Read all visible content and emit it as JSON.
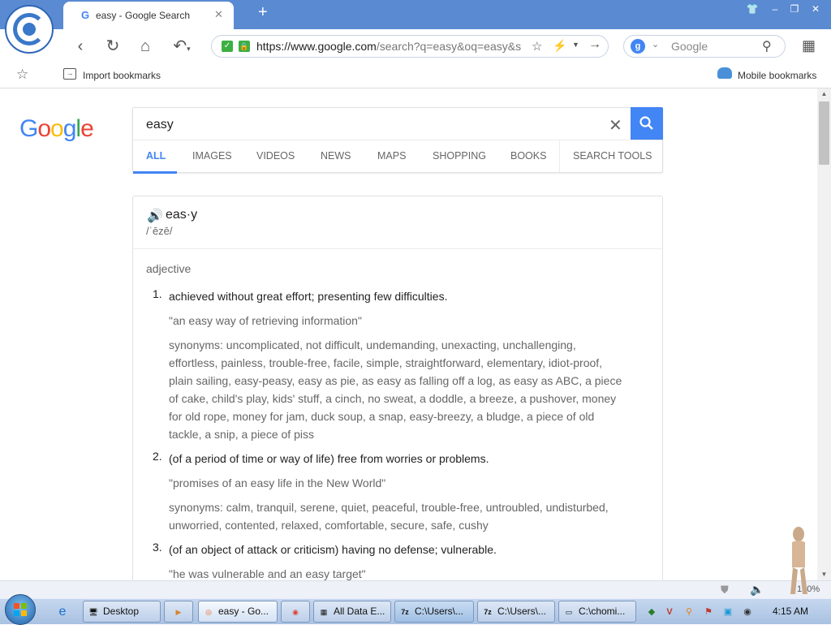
{
  "browser": {
    "tab": {
      "title": "easy - Google Search",
      "favicon": "G",
      "close": "✕"
    },
    "new_tab_icon": "+",
    "window_controls": {
      "shirt": "👕",
      "minimize": "–",
      "restore": "❐",
      "close": "✕"
    },
    "address": {
      "url_host": "https://www.google.com",
      "url_path": "/search?q=easy&oq=easy&s"
    },
    "search_placeholder": "Google",
    "engine_letter": "g"
  },
  "bookmarks": {
    "import_label": "Import bookmarks",
    "mobile_label": "Mobile bookmarks"
  },
  "google": {
    "logo_letters": [
      "G",
      "o",
      "o",
      "g",
      "l",
      "e"
    ],
    "logo_colors": [
      "#4285f4",
      "#ea4335",
      "#fbbc05",
      "#4285f4",
      "#34a853",
      "#ea4335"
    ],
    "query": "easy",
    "tabs": [
      "ALL",
      "IMAGES",
      "VIDEOS",
      "NEWS",
      "MAPS",
      "SHOPPING",
      "BOOKS",
      "SEARCH TOOLS"
    ],
    "active_tab": "ALL",
    "accent": "#4285f4"
  },
  "dictionary": {
    "headword": "eas·y",
    "pronunciation": "/ˈēzē/",
    "part_of_speech": "adjective",
    "definitions": [
      {
        "number": "1.",
        "text": "achieved without great effort; presenting few difficulties.",
        "example": "\"an easy way of retrieving information\"",
        "synonyms": "synonyms: uncomplicated, not difficult, undemanding, unexacting, unchallenging, effortless, painless, trouble-free, facile, simple, straightforward, elementary, idiot-proof, plain sailing, easy-peasy, easy as pie, as easy as falling off a log, as easy as ABC, a piece of cake, child's play, kids' stuff, a cinch, no sweat, a doddle, a breeze, a pushover, money for old rope, money for jam, duck soup, a snap, easy-breezy, a bludge, a piece of old tackle, a snip, a piece of piss"
      },
      {
        "number": "2.",
        "text": "(of a period of time or way of life) free from worries or problems.",
        "example": "\"promises of an easy life in the New World\"",
        "synonyms": "synonyms: calm, tranquil, serene, quiet, peaceful, trouble-free, untroubled, undisturbed, unworried, contented, relaxed, comfortable, secure, safe, cushy"
      },
      {
        "number": "3.",
        "text": "(of an object of attack or criticism) having no defense; vulnerable.",
        "example": "\"he was vulnerable and an easy target\""
      }
    ]
  },
  "statusbar": {
    "zoom": "100%"
  },
  "taskbar": {
    "tasks": [
      {
        "label": "Desktop",
        "icon": "🖥"
      },
      {
        "label": "",
        "icon": "▶"
      },
      {
        "label": "easy - Go...",
        "icon": "◎"
      },
      {
        "label": "",
        "icon": "◉"
      },
      {
        "label": "All Data E...",
        "icon": "▦"
      },
      {
        "label": "C:\\Users\\...",
        "icon": "7z"
      },
      {
        "label": "C:\\Users\\...",
        "icon": "7z"
      },
      {
        "label": "C:\\chomi...",
        "icon": "▭"
      }
    ],
    "clock": "4:15 AM"
  }
}
